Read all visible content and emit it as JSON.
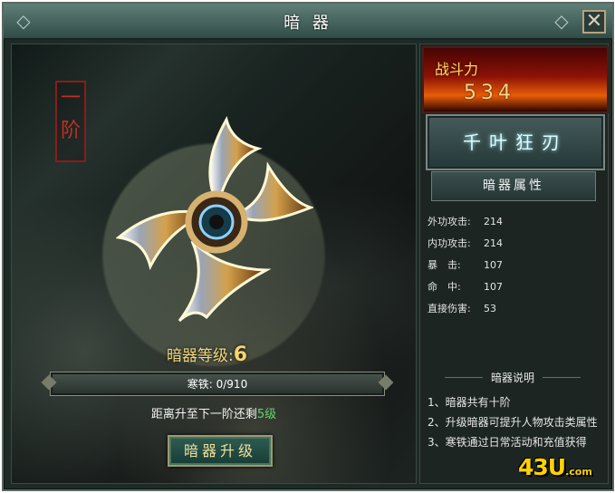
{
  "window": {
    "title": "暗 器",
    "close": "✕"
  },
  "left": {
    "tier": [
      "一",
      "阶"
    ],
    "level_label": "暗器等级:",
    "level_value": "6",
    "ore": "寒铁: 0/910",
    "remaining_prefix": "距离升至下一阶还剩",
    "remaining_value": "5级",
    "upgrade_label": "暗器升级"
  },
  "right": {
    "power_label": "战斗力",
    "power_value": "534",
    "weapon_name": "千叶狂刃",
    "attributes_title": "暗器属性",
    "stats": [
      {
        "key": "外功攻击:",
        "value": "214"
      },
      {
        "key": "内功攻击:",
        "value": "214"
      },
      {
        "key": "暴　击:",
        "value": "107"
      },
      {
        "key": "命　中:",
        "value": "107"
      },
      {
        "key": "直接伤害:",
        "value": "53"
      }
    ],
    "description_title": "暗器说明",
    "notes": [
      "1、暗器共有十阶",
      "2、升级暗器可提升人物攻击类属性",
      "3、寒铁通过日常活动和充值获得"
    ]
  },
  "logo": {
    "main": "43U",
    "suffix": ".com"
  },
  "colors": {
    "accent": "#f2d87b",
    "green": "#68d26f",
    "fire": "#e75d08"
  }
}
